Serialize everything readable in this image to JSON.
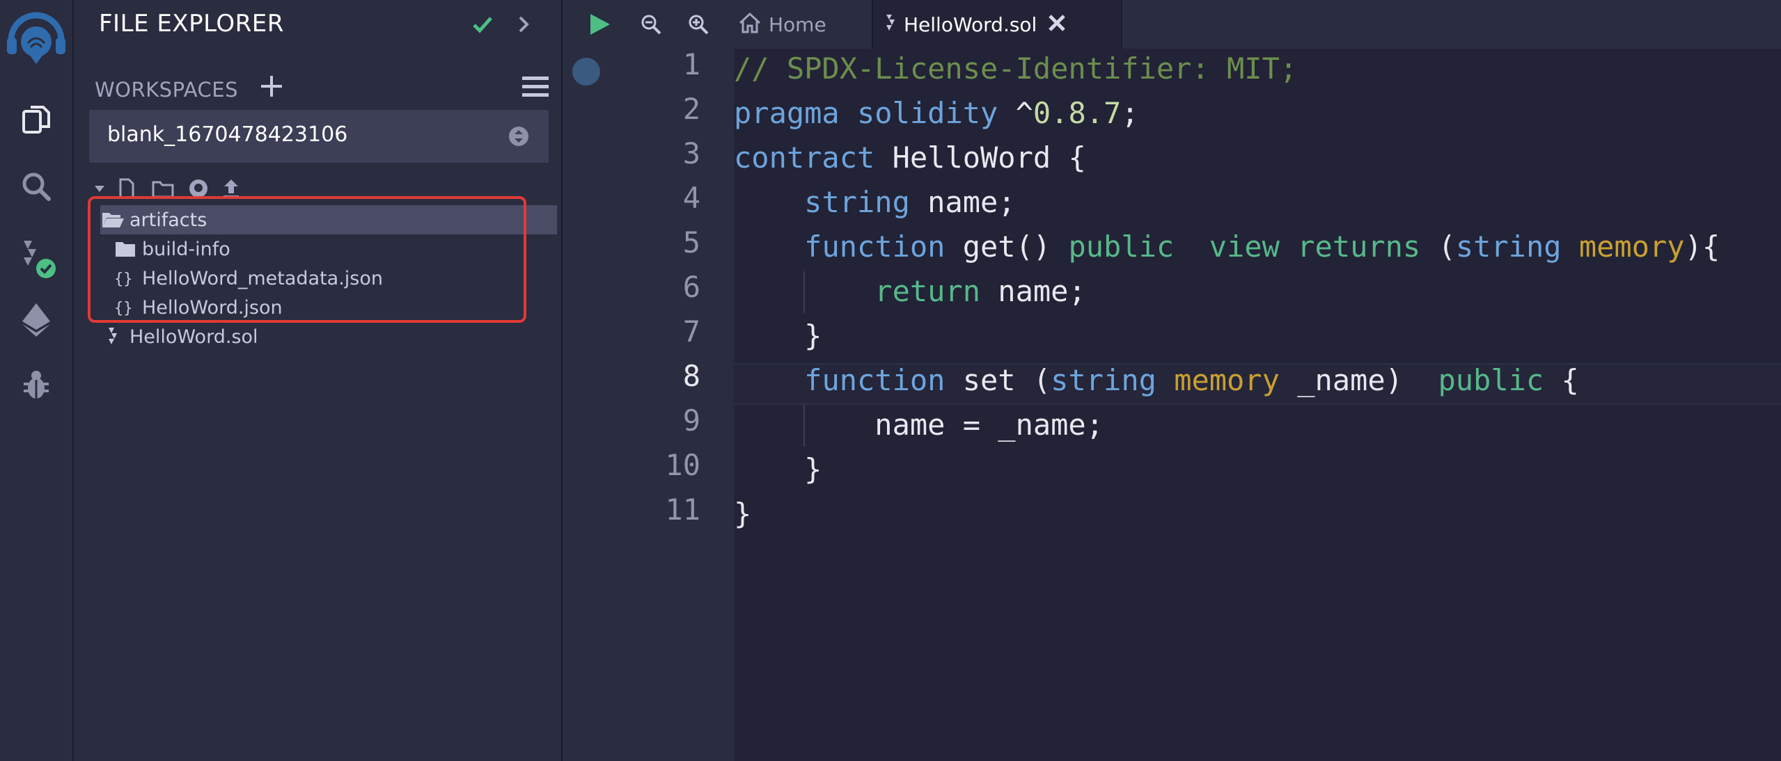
{
  "explorer": {
    "title": "FILE EXPLORER",
    "workspaces_label": "WORKSPACES",
    "workspace_selected": "blank_1670478423106",
    "tree": [
      {
        "name": "artifacts",
        "type": "folder-open"
      },
      {
        "name": "build-info",
        "type": "folder"
      },
      {
        "name": "HelloWord_metadata.json",
        "type": "json"
      },
      {
        "name": "HelloWord.json",
        "type": "json"
      },
      {
        "name": "HelloWord.sol",
        "type": "solidity"
      }
    ]
  },
  "tabs": {
    "home": "Home",
    "file": "HelloWord.sol"
  },
  "editor": {
    "line_numbers": [
      "1",
      "2",
      "3",
      "4",
      "5",
      "6",
      "7",
      "8",
      "9",
      "10",
      "11"
    ],
    "active_line": 8,
    "code_lines": [
      "// SPDX-License-Identifier: MIT;",
      "pragma solidity ^0.8.7;",
      "contract HelloWord {",
      "    string name;",
      "    function get() public  view returns (string memory){",
      "        return name;",
      "    }",
      "    function set (string memory _name)  public {",
      "        name = _name;",
      "    }",
      "}"
    ]
  },
  "colors": {
    "accent": "#2f6cae",
    "success": "#4dbf85",
    "highlight_box": "#e03a36"
  },
  "icons": [
    "remix-logo-icon",
    "files-icon",
    "search-icon",
    "solidity-compiler-icon",
    "deploy-icon",
    "debug-icon",
    "check-icon",
    "chevron-right-icon",
    "plus-icon",
    "hamburger-icon",
    "select-arrows-icon",
    "new-file-icon",
    "new-folder-icon",
    "github-icon",
    "upload-icon",
    "folder-open-icon",
    "folder-icon",
    "json-icon",
    "solidity-file-icon",
    "run-icon",
    "zoom-out-icon",
    "zoom-in-icon",
    "home-icon",
    "close-icon"
  ]
}
